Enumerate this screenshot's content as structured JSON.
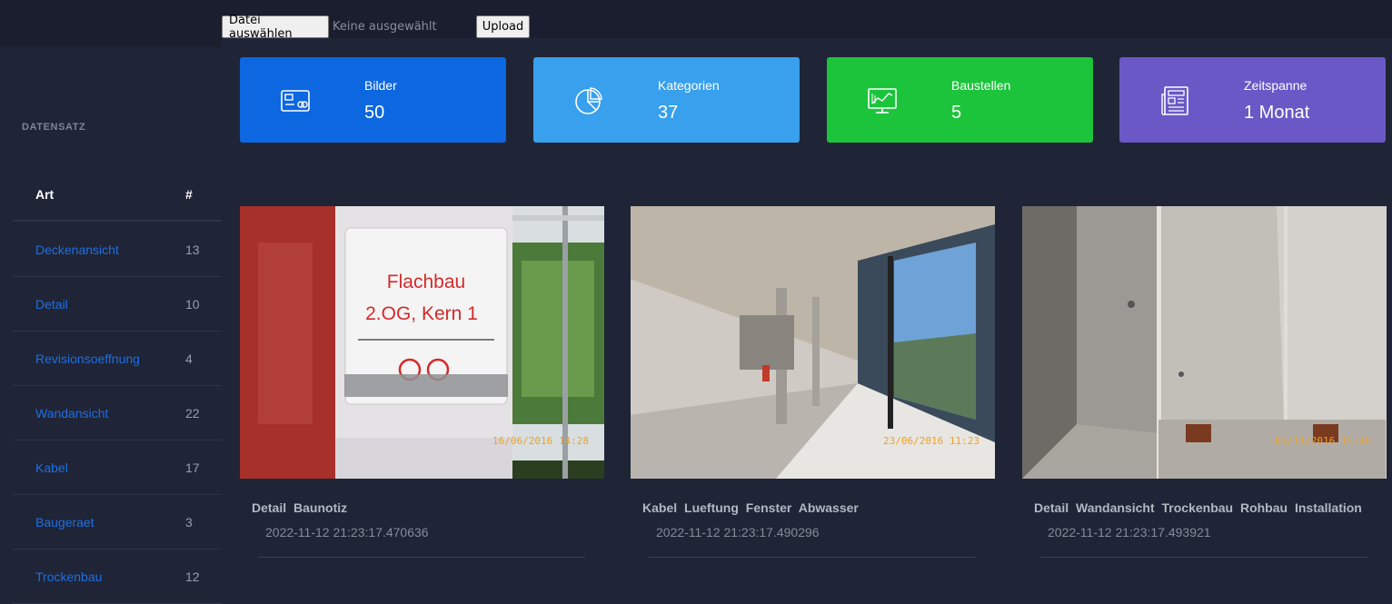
{
  "upload": {
    "choose_label": "Datei auswählen",
    "no_file": "Keine ausgewählt",
    "upload_label": "Upload"
  },
  "sidebar": {
    "heading": "DATENSATZ",
    "col_art": "Art",
    "col_count": "#",
    "items": [
      {
        "name": "Deckenansicht",
        "count": "13"
      },
      {
        "name": "Detail",
        "count": "10"
      },
      {
        "name": "Revisionsoeffnung",
        "count": "4"
      },
      {
        "name": "Wandansicht",
        "count": "22"
      },
      {
        "name": "Kabel",
        "count": "17"
      },
      {
        "name": "Baugeraet",
        "count": "3"
      },
      {
        "name": "Trockenbau",
        "count": "12"
      }
    ]
  },
  "cards": [
    {
      "label": "Bilder",
      "value": "50",
      "color": "#0c67e0",
      "icon": "card-icon"
    },
    {
      "label": "Kategorien",
      "value": "37",
      "color": "#38a0ec",
      "icon": "pie-chart-icon"
    },
    {
      "label": "Baustellen",
      "value": "5",
      "color": "#1cc43c",
      "icon": "monitor-chart-icon"
    },
    {
      "label": "Zeitspanne",
      "value": "1 Monat",
      "color": "#6a58c6",
      "icon": "newspaper-icon"
    }
  ],
  "gallery": [
    {
      "tags": "Detail Baunotiz",
      "date": "2022-11-12 21:23:17.470636",
      "sign_line1": "Flachbau",
      "sign_line2": "2.OG, Kern 1",
      "stamp": "16/06/2016 14:28"
    },
    {
      "tags": "Kabel Lueftung Fenster Abwasser",
      "date": "2022-11-12 21:23:17.490296",
      "stamp": "23/06/2016 11:23"
    },
    {
      "tags": "Detail Wandansicht Trockenbau Rohbau Installation",
      "date": "2022-11-12 21:23:17.493921",
      "stamp": "03/11/2016 15:48"
    }
  ]
}
